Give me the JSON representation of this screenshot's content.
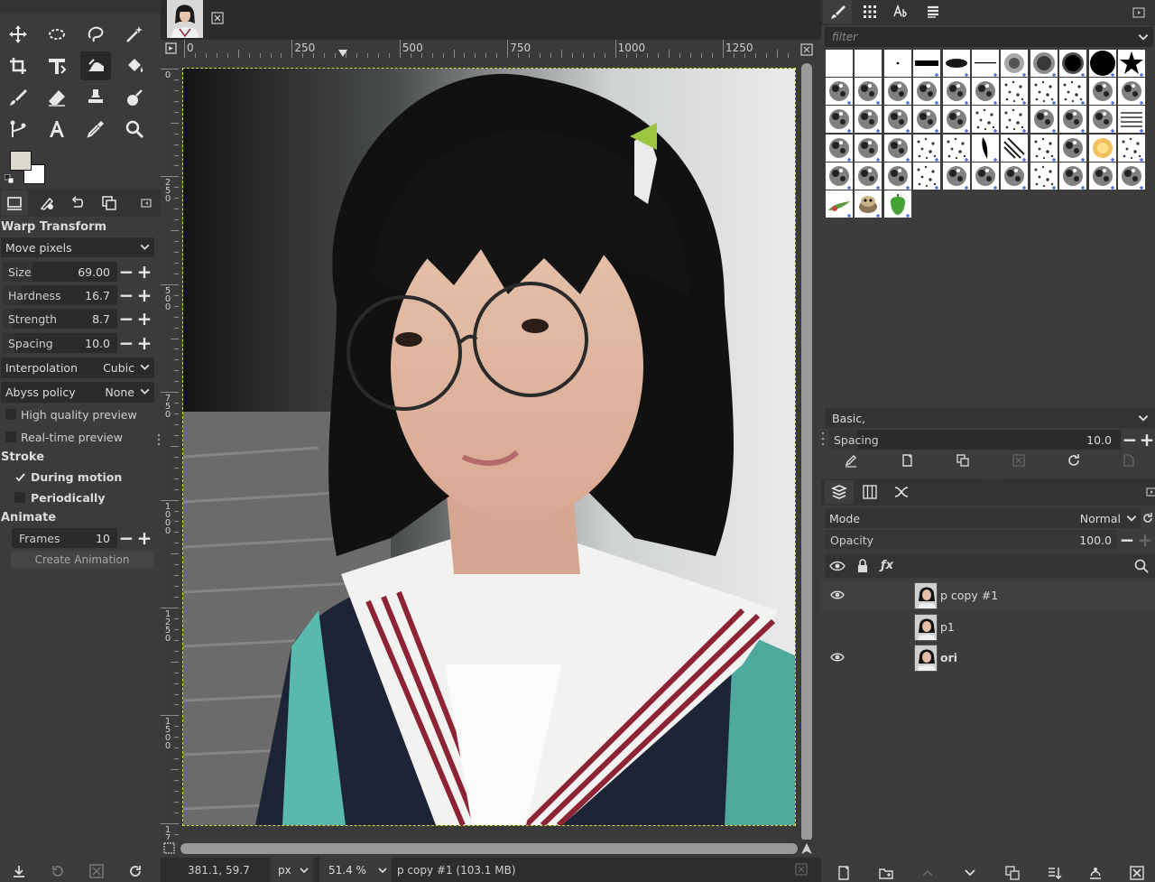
{
  "tool_options": {
    "title": "Warp Transform",
    "behavior": "Move pixels",
    "sliders": [
      {
        "label": "Size",
        "value": "69.00",
        "level": 0.26
      },
      {
        "label": "Hardness",
        "value": "16.7",
        "level": 0.17
      },
      {
        "label": "Strength",
        "value": "8.7",
        "level": 0.09
      },
      {
        "label": "Spacing",
        "value": "10.0",
        "level": 0.1
      }
    ],
    "interpolation": {
      "label": "Interpolation",
      "value": "Cubic"
    },
    "abyss": {
      "label": "Abyss policy",
      "value": "None"
    },
    "high_quality": {
      "label": "High quality preview",
      "checked": false
    },
    "realtime": {
      "label": "Real-time preview",
      "checked": false
    },
    "stroke_title": "Stroke",
    "during_motion": {
      "label": "During motion",
      "checked": true
    },
    "periodically": {
      "label": "Periodically",
      "checked": false
    },
    "animate_title": "Animate",
    "frames": {
      "label": "Frames",
      "value": "10"
    },
    "create_animation": "Create Animation"
  },
  "ruler": {
    "h_labels": [
      "0",
      "250",
      "500",
      "750",
      "1000",
      "1250"
    ],
    "v_labels": [
      "0",
      "250",
      "500",
      "750",
      "1000",
      "1250",
      "1500",
      "1750"
    ]
  },
  "status": {
    "coords": "381.1, 59.7",
    "unit": "px",
    "zoom": "51.4 %",
    "message": "p copy #1 (103.1 MB)"
  },
  "brushes_panel": {
    "filter_placeholder": "filter",
    "preset": "Basic,",
    "spacing_label": "Spacing",
    "spacing_value": "10.0"
  },
  "layers_panel": {
    "mode_label": "Mode",
    "mode_value": "Normal",
    "opacity_label": "Opacity",
    "opacity_value": "100.0",
    "layers": [
      {
        "name": "p copy #1",
        "visible": true,
        "active": true
      },
      {
        "name": "p1",
        "visible": false,
        "active": false
      },
      {
        "name": "ori",
        "visible": true,
        "active": false
      }
    ]
  },
  "colors": {
    "fg": "#dcd8cc",
    "bg": "#ffffff",
    "accent": "#e8e8e8"
  }
}
